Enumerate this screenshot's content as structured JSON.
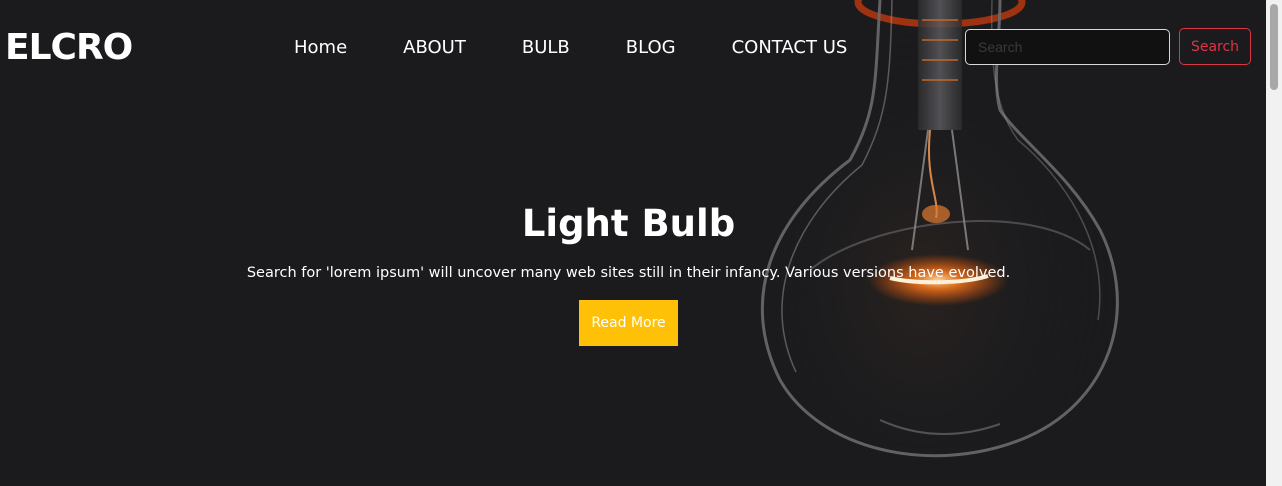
{
  "navbar": {
    "brand": "ELCRO",
    "links": [
      {
        "label": "Home"
      },
      {
        "label": "ABOUT"
      },
      {
        "label": "BULB"
      },
      {
        "label": "BLOG"
      },
      {
        "label": "CONTACT US"
      }
    ],
    "search": {
      "placeholder": "Search",
      "value": "",
      "button_label": "Search"
    }
  },
  "hero": {
    "title": "Light Bulb",
    "text": "Search for 'lorem ipsum' will uncover many web sites still in their infancy. Various versions have evolved.",
    "button_label": "Read More",
    "background_image": "light-bulb-photo"
  },
  "colors": {
    "background": "#1b1b1d",
    "accent": "#ffc107",
    "search_button": "#dc3545",
    "text": "#ffffff",
    "filament_glow": "#ff7a1a"
  }
}
